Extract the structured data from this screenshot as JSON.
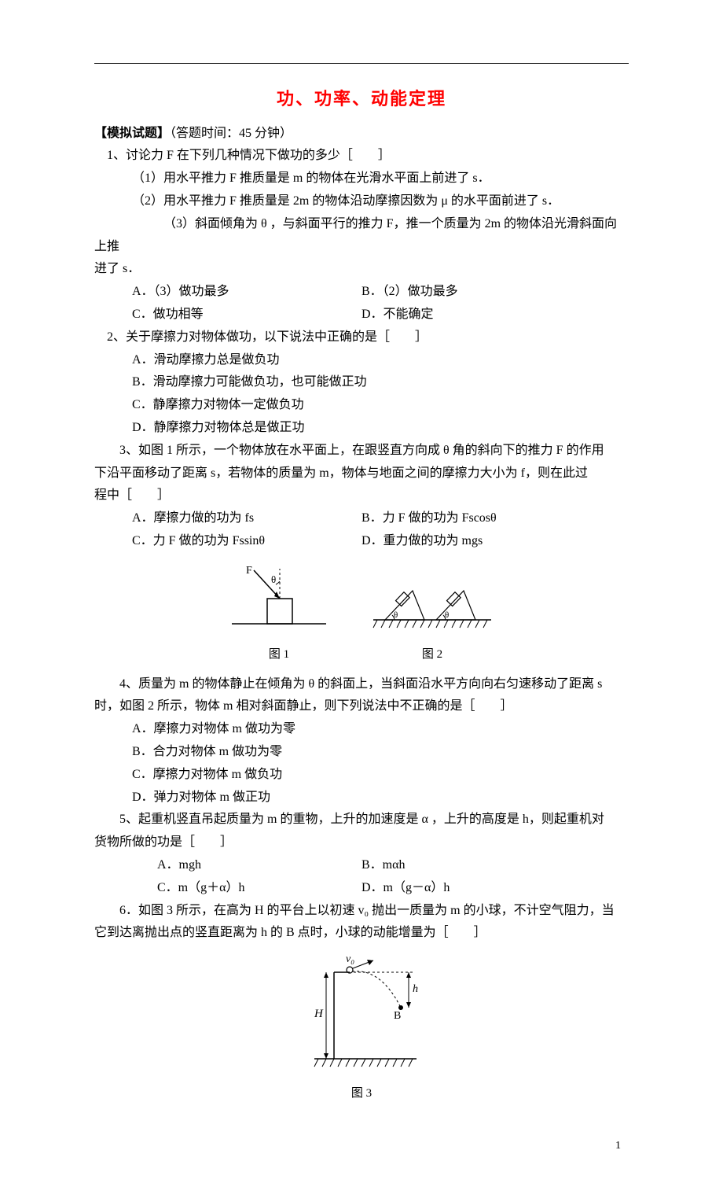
{
  "title": "功、功率、动能定理",
  "header": {
    "label": "【模拟试题】",
    "time": "（答题时间：45 分钟）"
  },
  "q1": {
    "stem": "1、讨论力 F 在下列几种情况下做功的多少［　　］",
    "p1": "（1）用水平推力 F 推质量是 m 的物体在光滑水平面上前进了 s．",
    "p2": "（2）用水平推力 F 推质量是 2m 的物体沿动摩擦因数为 μ 的水平面前进了 s．",
    "p3": "（3）斜面倾角为 θ ，与斜面平行的推力 F，推一个质量为 2m 的物体沿光滑斜面向上推进了 s．",
    "A": "A．（3）做功最多",
    "B": "B．（2）做功最多",
    "C": "C．做功相等",
    "D": "D．不能确定"
  },
  "q2": {
    "stem": "2、关于摩擦力对物体做功，以下说法中正确的是［　　］",
    "A": "A．滑动摩擦力总是做负功",
    "B": "B．滑动摩擦力可能做负功，也可能做正功",
    "C": "C．静摩擦力对物体一定做负功",
    "D": "D．静摩擦力对物体总是做正功"
  },
  "q3": {
    "stem": "3、如图 1 所示，一个物体放在水平面上，在跟竖直方向成 θ 角的斜向下的推力 F 的作用下沿平面移动了距离 s，若物体的质量为 m，物体与地面之间的摩擦力大小为 f，则在此过程中［　　］",
    "A": "A．摩擦力做的功为 fs",
    "B": "B．力 F 做的功为 Fscosθ",
    "C": "C．力 F 做的功为 Fssinθ",
    "D": "D．重力做的功为 mgs"
  },
  "fig1": {
    "caption": "图 1"
  },
  "fig2": {
    "caption": "图 2"
  },
  "q4": {
    "stem": "4、质量为 m 的物体静止在倾角为 θ 的斜面上，当斜面沿水平方向向右匀速移动了距离 s 时，如图 2 所示，物体 m 相对斜面静止，则下列说法中不正确的是［　　］",
    "A": "A．摩擦力对物体 m 做功为零",
    "B": "B．合力对物体 m 做功为零",
    "C": "C．摩擦力对物体 m 做负功",
    "D": "D．弹力对物体 m 做正功"
  },
  "q5": {
    "stem": "5、起重机竖直吊起质量为 m 的重物，上升的加速度是 α，上升的高度是 h，则起重机对货物所做的功是［　　］",
    "A": "A．mgh",
    "B": "B．mαh",
    "C": "C．m（g＋α）h",
    "D": "D．m（g－α）h"
  },
  "q6": {
    "stem": "6．如图 3 所示，在高为 H 的平台上以初速 v₀ 抛出一质量为 m 的小球，不计空气阻力，当它到达离抛出点的竖直距离为 h 的 B 点时，小球的动能增量为［　　］"
  },
  "fig3": {
    "caption": "图 3"
  },
  "labels": {
    "F": "F",
    "theta": "θ",
    "v0": "v₀",
    "H": "H",
    "h": "h",
    "B": "B"
  },
  "page": "1"
}
